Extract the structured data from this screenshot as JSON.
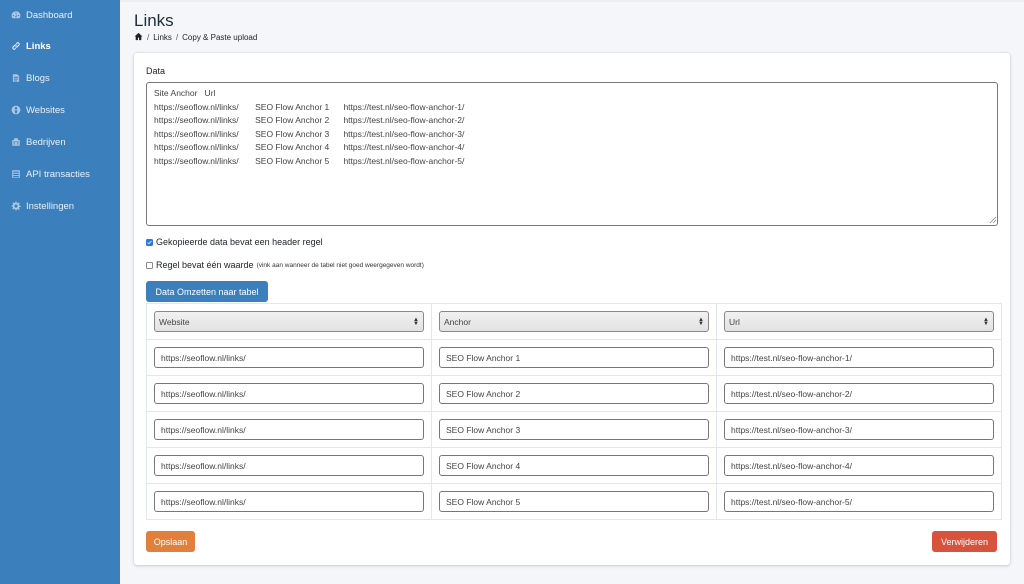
{
  "sidebar": {
    "items": [
      {
        "label": "Dashboard",
        "icon": "dashboard-icon"
      },
      {
        "label": "Links",
        "icon": "link-icon",
        "active": true
      },
      {
        "label": "Blogs",
        "icon": "blogs-icon"
      },
      {
        "label": "Websites",
        "icon": "globe-icon"
      },
      {
        "label": "Bedrijven",
        "icon": "building-icon"
      },
      {
        "label": "API transacties",
        "icon": "database-icon"
      },
      {
        "label": "Instellingen",
        "icon": "gear-icon"
      }
    ]
  },
  "header": {
    "title": "Links",
    "breadcrumb": [
      "Links",
      "Copy & Paste upload"
    ]
  },
  "form": {
    "data_label": "Data",
    "textarea_value": "Site Anchor   Url\nhttps://seoflow.nl/links/       SEO Flow Anchor 1      https://test.nl/seo-flow-anchor-1/\nhttps://seoflow.nl/links/       SEO Flow Anchor 2      https://test.nl/seo-flow-anchor-2/\nhttps://seoflow.nl/links/       SEO Flow Anchor 3      https://test.nl/seo-flow-anchor-3/\nhttps://seoflow.nl/links/       SEO Flow Anchor 4      https://test.nl/seo-flow-anchor-4/\nhttps://seoflow.nl/links/       SEO Flow Anchor 5      https://test.nl/seo-flow-anchor-5/",
    "header_checkbox_label": "Gekopieerde data bevat een header regel",
    "header_checkbox_checked": true,
    "single_value_label": "Regel bevat één waarde",
    "single_value_hint": "(vink aan wanneer de tabel niet goed weergegeven wordt)",
    "single_value_checked": false,
    "convert_button": "Data Omzetten naar tabel"
  },
  "table": {
    "columns": [
      "Website",
      "Anchor",
      "Url"
    ],
    "rows": [
      [
        "https://seoflow.nl/links/",
        "SEO Flow Anchor 1",
        "https://test.nl/seo-flow-anchor-1/"
      ],
      [
        "https://seoflow.nl/links/",
        "SEO Flow Anchor 2",
        "https://test.nl/seo-flow-anchor-2/"
      ],
      [
        "https://seoflow.nl/links/",
        "SEO Flow Anchor 3",
        "https://test.nl/seo-flow-anchor-3/"
      ],
      [
        "https://seoflow.nl/links/",
        "SEO Flow Anchor 4",
        "https://test.nl/seo-flow-anchor-4/"
      ],
      [
        "https://seoflow.nl/links/",
        "SEO Flow Anchor 5",
        "https://test.nl/seo-flow-anchor-5/"
      ]
    ]
  },
  "actions": {
    "save": "Opslaan",
    "delete": "Verwijderen"
  },
  "colors": {
    "sidebar": "#3c7fbd",
    "primary": "#3c7fbd",
    "save": "#e0803a",
    "delete": "#d9533c"
  }
}
